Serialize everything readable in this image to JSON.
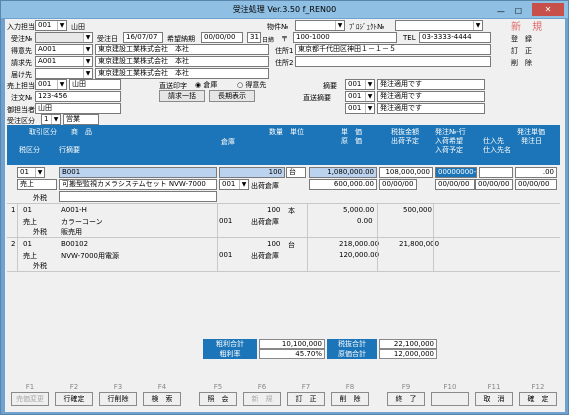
{
  "window": {
    "title": "受注処理 Ver.3.50 f_REN00",
    "close": "✕",
    "min": "—",
    "max": "☐"
  },
  "stamp": "新 規",
  "header": {
    "input_person_lbl": "入力担当",
    "input_person_code": "001",
    "input_person_name": "山田",
    "bukken_lbl": "物件№",
    "project_lbl": "ﾌﾟﾛｼﾞｪｸﾄ№",
    "juchu_lbl": "受注№",
    "juchu_date_lbl": "受注日",
    "juchu_date": "16/07/07",
    "kibou_lbl": "希望納期",
    "kibou_date": "00/00/00",
    "kibou_day": "31",
    "kibou_suffix": "日締",
    "postal_mark": "〒",
    "postal": "100-1000",
    "tel_lbl": "TEL",
    "tel": "03-3333-4444",
    "customer_lbl": "得意先",
    "customer_code": "A001",
    "customer_name": "東京建設工業株式会社　本社",
    "addr1_lbl": "住所1",
    "addr1": "東京都千代田区神田１－１－５",
    "billing_lbl": "請求先",
    "billing_code": "A001",
    "billing_name": "東京建設工業株式会社　本社",
    "addr2_lbl": "住所2",
    "delivery_lbl": "届け先",
    "delivery_name": "東京建設工業株式会社　本社",
    "sales_lbl": "売上担当",
    "sales_code": "001",
    "sales_name": "山田",
    "direct_lbl": "直送印字",
    "radio_warehouse": "倉庫",
    "radio_customer": "得意先",
    "note_lbl": "摘要",
    "note_code": "001",
    "note_text": "発注適用です",
    "order_doc_lbl": "注文№",
    "order_doc": "123-456",
    "bill_btn": "請求一括",
    "disp_btn": "長期表示",
    "direct_note_lbl": "直送摘要",
    "direct_note_code": "001",
    "direct_note_text": "発注適用です",
    "contact_lbl": "御担当者",
    "contact": "山田",
    "note3_code": "001",
    "note3_text": "発注適用です",
    "order_type_lbl": "受注区分",
    "order_type_code": "1",
    "order_type_name": "営業"
  },
  "action_side": {
    "register": "登　録",
    "correct": "訂　正",
    "delete": "削　除"
  },
  "grid_header": {
    "c1": "取引区分",
    "c2": "商　品",
    "c3": "倉庫",
    "c4": "数量",
    "c5": "単位",
    "c6": "単　価",
    "c7": "原　価",
    "c8": "税抜金額",
    "c9": "出荷予定",
    "c10": "発注№-行",
    "c11": "入荷希望",
    "c12": "入荷予定",
    "c13": "仕入先",
    "c14": "仕入先名",
    "c15": "発注単価",
    "c16": "発注日",
    "c17": "税区分",
    "c18": "行摘要"
  },
  "edit_row": {
    "trade_code": "01",
    "item_code": "B001",
    "qty": "100",
    "unit": "台",
    "unit_price": "1,080,000.00",
    "amount": "108,000,000",
    "po_no": "00000000-",
    "po_price": ".00",
    "trade_name": "売上",
    "item_name": "可搬型監視カメラシステムセット NVW-7000",
    "wh_code": "001",
    "wh_name": "出荷倉庫",
    "cost": "600,000.00",
    "ship_date": "00/00/00",
    "arr1": "00/00/00",
    "arr2": "00/00/00",
    "po_date": "00/00/00",
    "tax_lbl": "外税"
  },
  "rows": [
    {
      "no": "1",
      "trade_code": "01",
      "item_code": "A001-H",
      "qty": "100",
      "unit": "本",
      "unit_price": "5,000.00",
      "amount": "500,000",
      "trade_name": "売上",
      "item_name": "カラーコーン",
      "wh_code": "001",
      "wh_name": "出荷倉庫",
      "cost": "0.00",
      "tax": "外税",
      "memo": "販売用"
    },
    {
      "no": "2",
      "trade_code": "01",
      "item_code": "B00102",
      "qty": "100",
      "unit": "台",
      "unit_price": "218,000.00",
      "amount": "21,800,000",
      "trade_name": "売上",
      "item_name": "NVW-7000用電源",
      "wh_code": "001",
      "wh_name": "出荷倉庫",
      "cost": "120,000.00",
      "tax": "外税",
      "memo": ""
    }
  ],
  "totals": {
    "profit_lbl": "粗利合計",
    "profit": "10,100,000",
    "rate_lbl": "粗利率",
    "rate": "45.70%",
    "taxex_lbl": "税抜合計",
    "taxex": "22,100,000",
    "cost_lbl": "原価合計",
    "cost": "12,000,000"
  },
  "fkeys": [
    {
      "key": "F1",
      "label": "売価変更",
      "enabled": false
    },
    {
      "key": "F2",
      "label": "行確定",
      "enabled": true
    },
    {
      "key": "F3",
      "label": "行削除",
      "enabled": true
    },
    {
      "key": "F4",
      "label": "検　索",
      "enabled": true
    },
    {
      "key": "F5",
      "label": "照　会",
      "enabled": true
    },
    {
      "key": "F6",
      "label": "新　規",
      "enabled": false
    },
    {
      "key": "F7",
      "label": "訂　正",
      "enabled": true
    },
    {
      "key": "F8",
      "label": "削　除",
      "enabled": true
    },
    {
      "key": "F9",
      "label": "終　了",
      "enabled": true
    },
    {
      "key": "F10",
      "label": "",
      "enabled": false
    },
    {
      "key": "F11",
      "label": "取　消",
      "enabled": true
    },
    {
      "key": "F12",
      "label": "確　定",
      "enabled": true
    }
  ]
}
